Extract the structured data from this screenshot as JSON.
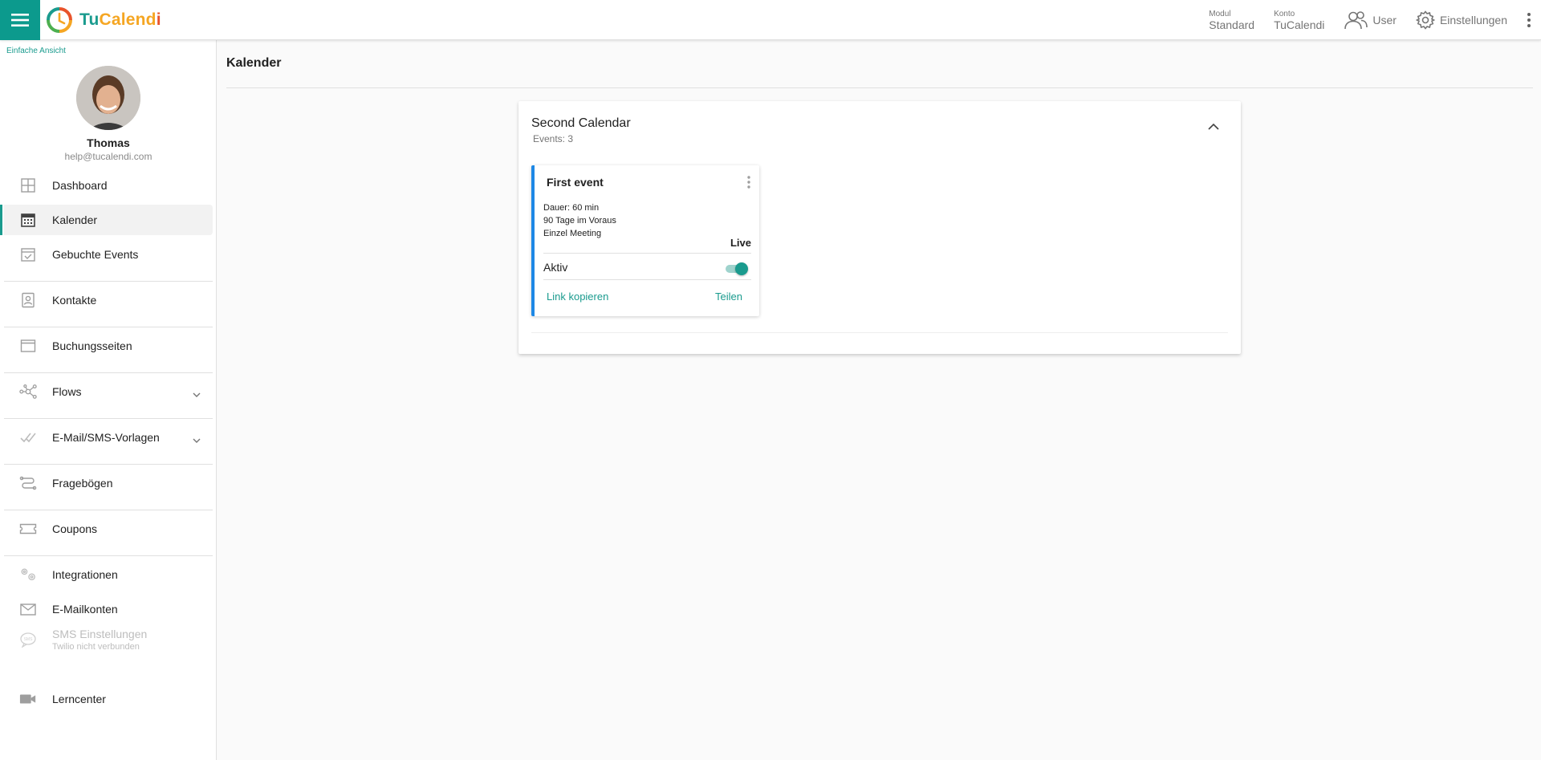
{
  "topbar": {
    "brand": {
      "part1": "Tu",
      "part2": "Calend",
      "part3": "i"
    },
    "modul": {
      "label": "Modul",
      "value": "Standard"
    },
    "konto": {
      "label": "Konto",
      "value": "TuCalendi"
    },
    "user_label": "User",
    "settings_label": "Einstellungen"
  },
  "sidebar": {
    "simple_view": "Einfache Ansicht",
    "profile": {
      "name": "Thomas",
      "email": "help@tucalendi.com"
    },
    "items": [
      {
        "label": "Dashboard",
        "icon": "dashboard-icon"
      },
      {
        "label": "Kalender",
        "icon": "calendar-icon",
        "active": true
      },
      {
        "label": "Gebuchte Events",
        "icon": "calendar-check-icon"
      },
      {
        "label": "Kontakte",
        "icon": "contacts-icon"
      },
      {
        "label": "Buchungsseiten",
        "icon": "browser-window-icon"
      },
      {
        "label": "Flows",
        "icon": "flows-icon",
        "expandable": true
      },
      {
        "label": "E-Mail/SMS-Vorlagen",
        "icon": "checkmarks-icon",
        "expandable": true
      },
      {
        "label": "Fragebögen",
        "icon": "questionnaire-icon"
      },
      {
        "label": "Coupons",
        "icon": "coupon-icon"
      },
      {
        "label": "Integrationen",
        "icon": "gears-icon"
      },
      {
        "label": "E-Mailkonten",
        "icon": "envelope-icon"
      },
      {
        "label": "SMS Einstellungen",
        "sublabel": "Twilio nicht verbunden",
        "icon": "sms-icon",
        "disabled": true
      },
      {
        "label": "Lerncenter",
        "icon": "video-camera-icon"
      }
    ]
  },
  "main": {
    "page_title": "Kalender",
    "calendar": {
      "name": "Second Calendar",
      "events_count": "Events: 3",
      "event": {
        "title": "First event",
        "duration": "Dauer: 60 min",
        "advance": "90 Tage im Voraus",
        "type": "Einzel Meeting",
        "status": "Live",
        "active_label": "Aktiv",
        "active": true,
        "copy_link": "Link kopieren",
        "share": "Teilen"
      }
    }
  },
  "colors": {
    "accent": "#1a9b8e",
    "menu_button": "#0c9a8d",
    "event_border": "#1e88e5",
    "brand_orange": "#f5a623",
    "brand_red": "#e8542c"
  }
}
